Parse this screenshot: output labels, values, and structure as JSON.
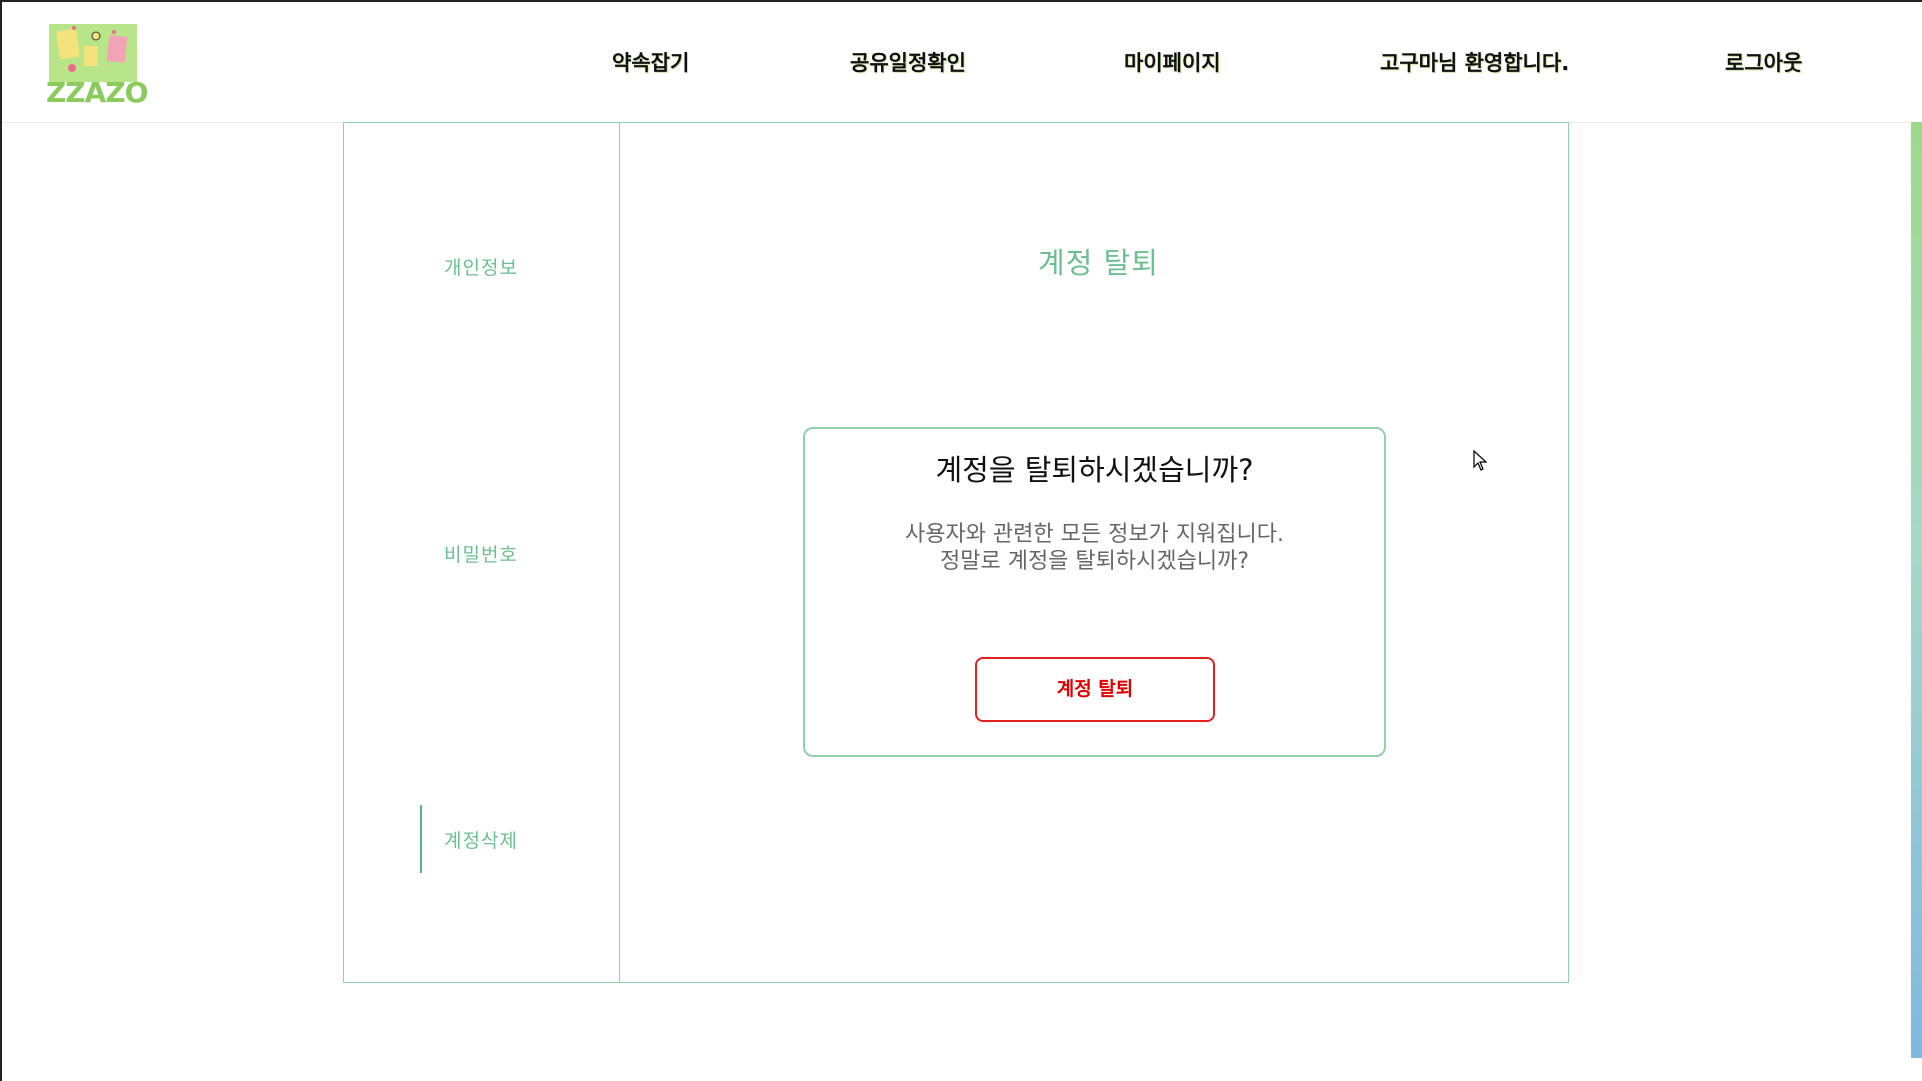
{
  "logo": {
    "text": "ZZAZO"
  },
  "nav": {
    "items": [
      "약속잡기",
      "공유일정확인",
      "마이페이지",
      "고구마님 환영합니다.",
      "로그아웃"
    ]
  },
  "sidebar": {
    "items": [
      {
        "label": "개인정보"
      },
      {
        "label": "비밀번호"
      },
      {
        "label": "계정삭제",
        "active": true
      }
    ]
  },
  "main": {
    "title": "계정 탈퇴",
    "dialog": {
      "question": "계정을 탈퇴하시겠습니까?",
      "message_line1": "사용자와 관련한 모든 정보가 지워집니다.",
      "message_line2": "정말로 계정을 탈퇴하시겠습니까?",
      "button_label": "계정 탈퇴"
    }
  },
  "colors": {
    "accent_green": "#6dbf92",
    "border_green": "#8fd0ad",
    "danger_red": "#e00000"
  }
}
